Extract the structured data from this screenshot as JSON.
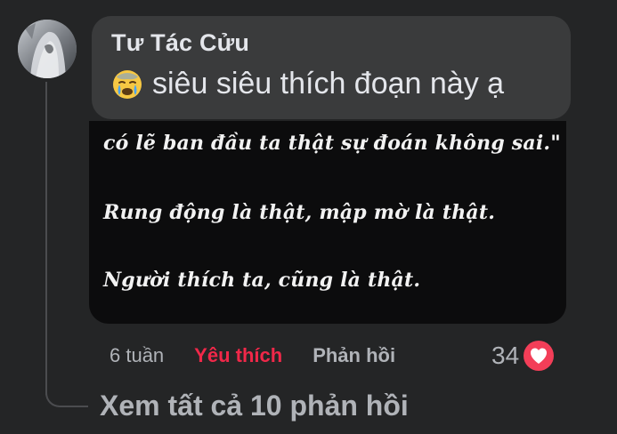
{
  "comment": {
    "author": "Tư Tác Cửu",
    "emoji": "crying-face",
    "text": "siêu siêu thích đoạn này ạ",
    "attachment_lines": [
      "có lẽ ban đầu ta thật sự đoán không sai.\"",
      "Rung động là thật, mập mờ là thật.",
      "Người thích ta, cũng là thật."
    ]
  },
  "actions": {
    "time": "6 tuần",
    "like_label": "Yêu thích",
    "reply_label": "Phản hồi",
    "reaction_count": "34",
    "reaction_icon": "heart-icon",
    "like_color": "#f02849"
  },
  "replies": {
    "view_all_label": "Xem tất cả 10 phản hồi"
  },
  "theme": {
    "background": "#242526",
    "bubble": "#3a3b3c",
    "text_primary": "#e4e6eb",
    "text_secondary": "#b0b3b8"
  }
}
